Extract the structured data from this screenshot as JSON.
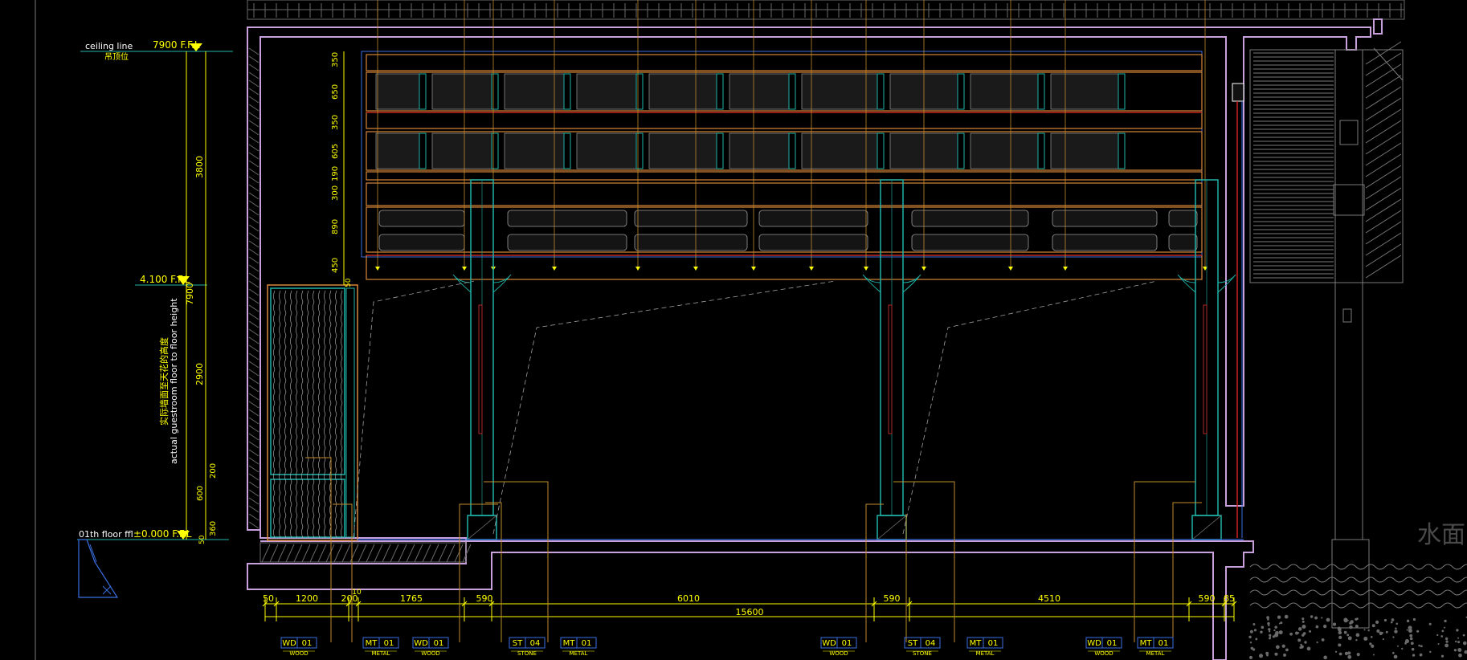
{
  "levels": {
    "ceiling_label": "ceiling line",
    "ceiling_label_cn": "吊顶位",
    "ceiling_value": "7900 F.F.L",
    "mid_value": "4.100 F.F.L",
    "floor_label": "01th floor ffl",
    "floor_value": "±0.000 F.F.L"
  },
  "vertical_note": {
    "cn": "实际墙面至天花的高度",
    "en": "actual guestroom floor to floor height"
  },
  "left_dims": [
    "3800",
    "7900",
    "2900",
    "200",
    "600",
    "360",
    "50"
  ],
  "inner_dims": [
    "350",
    "650",
    "350",
    "605",
    "190",
    "300",
    "890",
    "450",
    "50"
  ],
  "bottom_dims": [
    "50",
    "1200",
    "200",
    "10",
    "1765",
    "590",
    "6010",
    "590",
    "4510",
    "590",
    "85"
  ],
  "overall_dim": "15600",
  "material_tags": [
    {
      "code": "WD",
      "num": "01",
      "desc": "WOOD"
    },
    {
      "code": "MT",
      "num": "01",
      "desc": "METAL"
    },
    {
      "code": "WD",
      "num": "01",
      "desc": "WOOD"
    },
    {
      "code": "ST",
      "num": "04",
      "desc": "STONE"
    },
    {
      "code": "MT",
      "num": "01",
      "desc": "METAL"
    },
    {
      "code": "WD",
      "num": "01",
      "desc": "WOOD"
    },
    {
      "code": "ST",
      "num": "04",
      "desc": "STONE"
    },
    {
      "code": "MT",
      "num": "01",
      "desc": "METAL"
    },
    {
      "code": "WD",
      "num": "01",
      "desc": "WOOD"
    },
    {
      "code": "MT",
      "num": "01",
      "desc": "METAL"
    }
  ],
  "water_label": "水面",
  "colors": {
    "background": "#000000",
    "wall": "#c9a0dc",
    "timber": "#d7873a",
    "column": "#1fb3a8",
    "dim": "#ffff00",
    "leader": "#c08a2c",
    "grid": "#5a5a5a"
  }
}
